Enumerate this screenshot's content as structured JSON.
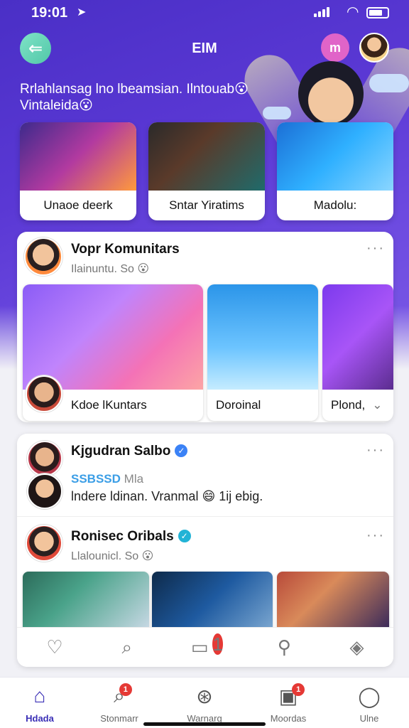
{
  "status_bar": {
    "time": "19:01"
  },
  "header": {
    "title": "EIM",
    "app_icon_glyph": "m"
  },
  "hero": {
    "line1": "Rrlahlansag lno lbeamsian. Ilntouab",
    "line1_emoji": "😮",
    "line2": "Vintaleida",
    "line2_emoji": "😮"
  },
  "featured": [
    {
      "label": "Unaoe deerk"
    },
    {
      "label": "Sntar Yiratims"
    },
    {
      "label": "Madolu:"
    }
  ],
  "community_card": {
    "name": "Vopr Komunitars",
    "sub": "Ilainuntu. So",
    "sub_emoji": "😮",
    "thumbs": [
      {
        "caption": "Kdoe lKuntars"
      },
      {
        "caption": "Doroinal"
      },
      {
        "caption": "Plond,"
      }
    ]
  },
  "post_card": {
    "post1": {
      "name": "Kjgudran Salbo",
      "line1": "SSBSSD",
      "line1_rest": "Mla",
      "line2": "lndere ldinan. Vranmal",
      "line2_emoji": "😄",
      "line2_rest": "1ij ebig."
    },
    "post2": {
      "name": "Ronisec Oribals",
      "sub": "Llalounicl. So",
      "sub_emoji": "😮"
    },
    "actions": [
      "heart-icon",
      "search-icon",
      "comment-icon",
      "share-icon",
      "check-icon"
    ],
    "comment_badge": "1"
  },
  "tabs": [
    {
      "label": "Hdada",
      "badge": ""
    },
    {
      "label": "Stonmarr",
      "badge": "1"
    },
    {
      "label": "Warnarg",
      "badge": ""
    },
    {
      "label": "Moordas",
      "badge": "1"
    },
    {
      "label": "Ulne",
      "badge": ""
    }
  ],
  "colors": {
    "accent": "#3a2fb6",
    "hero_start": "#4a2fc6",
    "hero_end": "#7c5ae6",
    "verified_blue": "#3b82f6",
    "verified_teal": "#22b3d6",
    "badge_red": "#e53935"
  }
}
